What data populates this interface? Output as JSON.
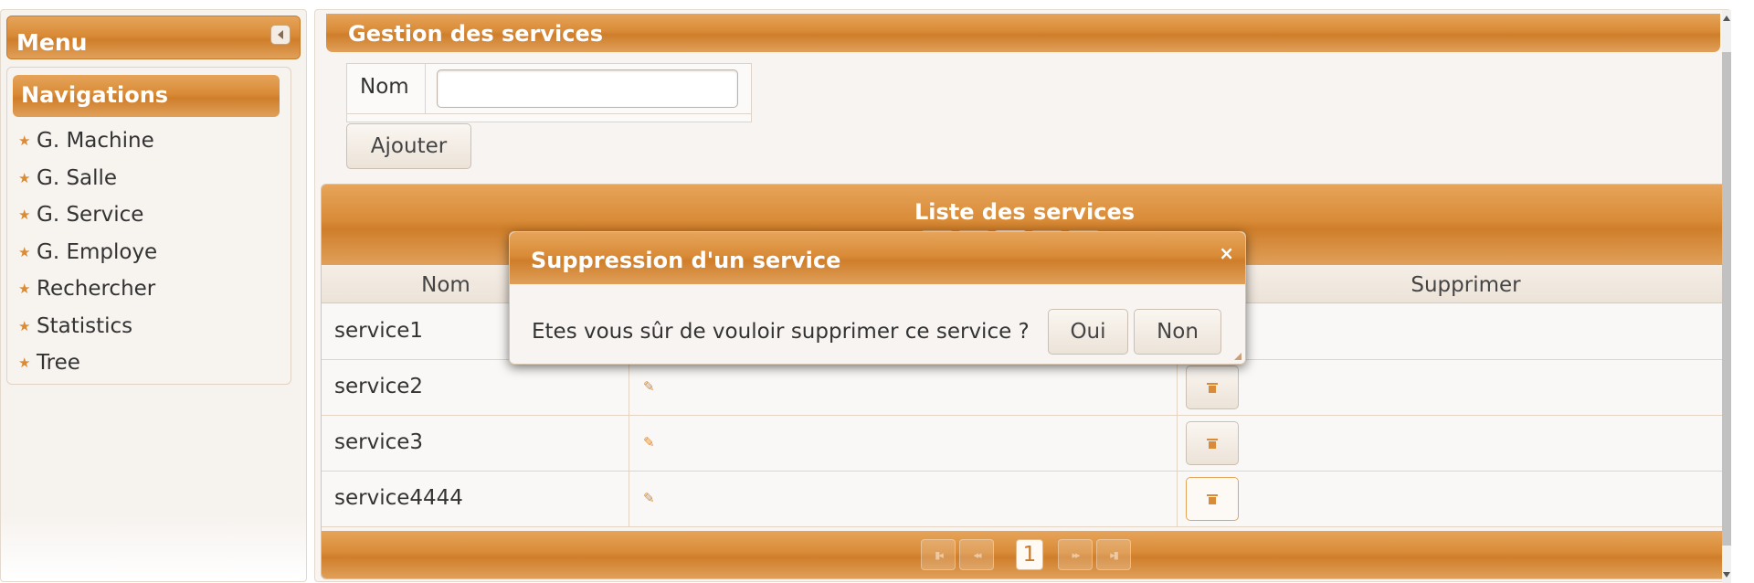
{
  "menu": {
    "title": "Menu",
    "nav_title": "Navigations",
    "items": [
      {
        "label": "G. Machine"
      },
      {
        "label": "G. Salle"
      },
      {
        "label": "G. Service"
      },
      {
        "label": "G. Employe"
      },
      {
        "label": "Rechercher"
      },
      {
        "label": "Statistics"
      },
      {
        "label": "Tree"
      }
    ]
  },
  "gestion": {
    "title": "Gestion des services",
    "nom_label": "Nom",
    "nom_value": "",
    "add_button": "Ajouter"
  },
  "list": {
    "title": "Liste des services",
    "columns": [
      "Nom",
      "Supprimer"
    ],
    "rows": [
      {
        "name": "service1"
      },
      {
        "name": "service2"
      },
      {
        "name": "service3"
      },
      {
        "name": "service4444"
      }
    ],
    "current_page": "1"
  },
  "dialog": {
    "title": "Suppression d'un service",
    "close": "×",
    "message": "Etes vous sûr de vouloir supprimer ce service ?",
    "yes": "Oui",
    "no": "Non"
  },
  "colors": {
    "accent": "#d98b37",
    "panel_bg": "#f7f4f1"
  }
}
